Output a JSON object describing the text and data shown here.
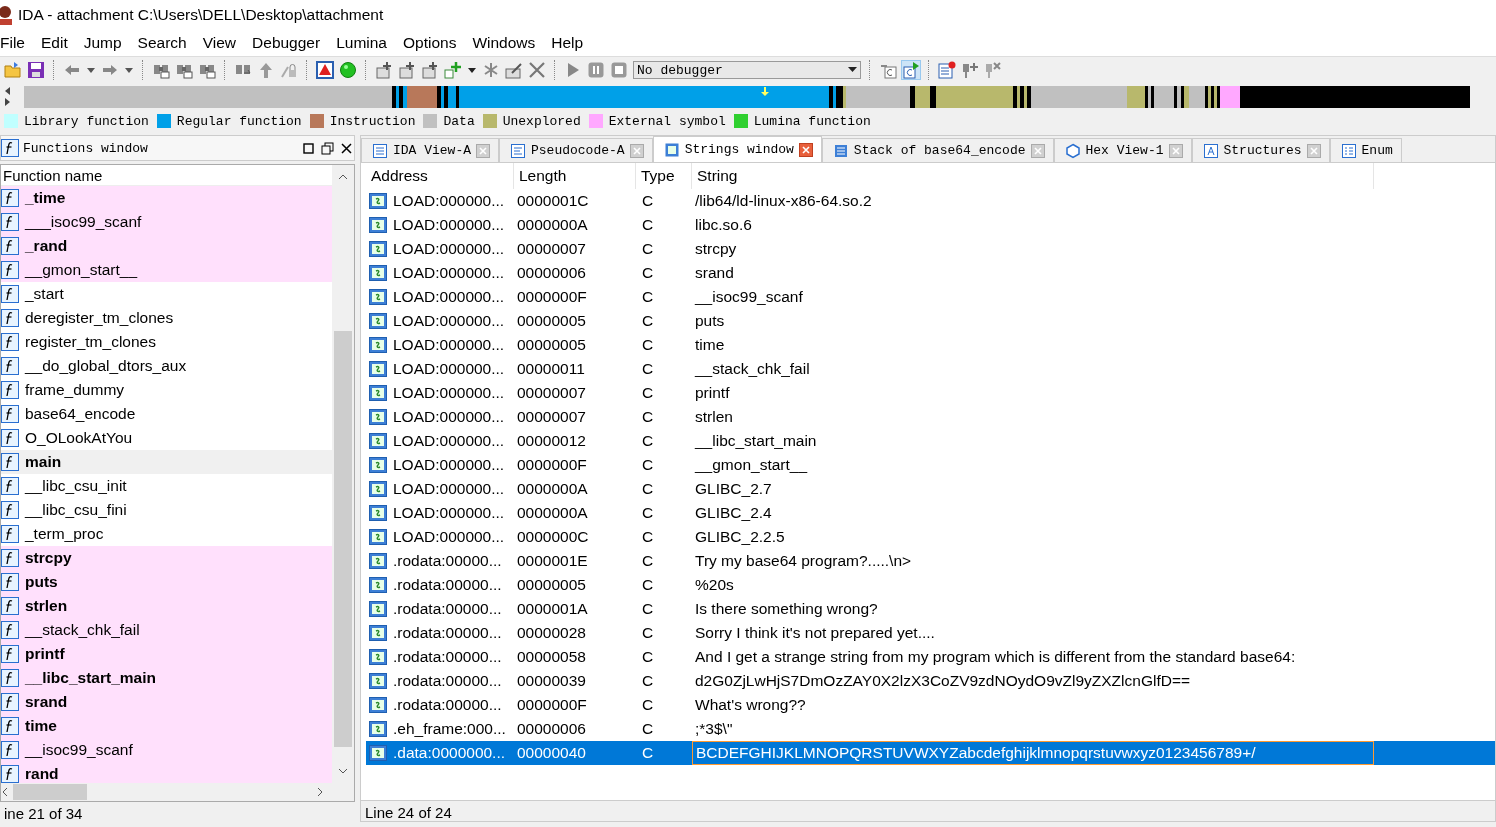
{
  "window": {
    "title": "IDA - attachment C:\\Users\\DELL\\Desktop\\attachment"
  },
  "menu": [
    "File",
    "Edit",
    "Jump",
    "Search",
    "View",
    "Debugger",
    "Lumina",
    "Options",
    "Windows",
    "Help"
  ],
  "toolbar": {
    "debugger_select": {
      "value": "No debugger"
    }
  },
  "legend": [
    {
      "label": "Library function",
      "color": "#c0ffff"
    },
    {
      "label": "Regular function",
      "color": "#00a0e8"
    },
    {
      "label": "Instruction",
      "color": "#b8785a"
    },
    {
      "label": "Data",
      "color": "#c0c0c0"
    },
    {
      "label": "Unexplored",
      "color": "#b8b86c"
    },
    {
      "label": "External symbol",
      "color": "#ffa8ff"
    },
    {
      "label": "Lumina function",
      "color": "#30d030"
    }
  ],
  "functions_window": {
    "title": "Functions window",
    "column": "Function name",
    "items": [
      {
        "name": "_time",
        "bold": true,
        "external": true,
        "selected": false
      },
      {
        "name": "___isoc99_scanf",
        "bold": false,
        "external": true,
        "selected": false
      },
      {
        "name": "_rand",
        "bold": true,
        "external": true,
        "selected": false
      },
      {
        "name": "__gmon_start__",
        "bold": false,
        "external": true,
        "selected": false
      },
      {
        "name": "_start",
        "bold": false,
        "external": false,
        "selected": false
      },
      {
        "name": "deregister_tm_clones",
        "bold": false,
        "external": false,
        "selected": false
      },
      {
        "name": "register_tm_clones",
        "bold": false,
        "external": false,
        "selected": false
      },
      {
        "name": "__do_global_dtors_aux",
        "bold": false,
        "external": false,
        "selected": false
      },
      {
        "name": "frame_dummy",
        "bold": false,
        "external": false,
        "selected": false
      },
      {
        "name": "base64_encode",
        "bold": false,
        "external": false,
        "selected": false
      },
      {
        "name": "O_OLookAtYou",
        "bold": false,
        "external": false,
        "selected": false
      },
      {
        "name": "main",
        "bold": true,
        "external": false,
        "selected": true
      },
      {
        "name": "__libc_csu_init",
        "bold": false,
        "external": false,
        "selected": false
      },
      {
        "name": "__libc_csu_fini",
        "bold": false,
        "external": false,
        "selected": false
      },
      {
        "name": "_term_proc",
        "bold": false,
        "external": false,
        "selected": false
      },
      {
        "name": "strcpy",
        "bold": true,
        "external": true,
        "selected": false
      },
      {
        "name": "puts",
        "bold": true,
        "external": true,
        "selected": false
      },
      {
        "name": "strlen",
        "bold": true,
        "external": true,
        "selected": false
      },
      {
        "name": "__stack_chk_fail",
        "bold": false,
        "external": true,
        "selected": false
      },
      {
        "name": "printf",
        "bold": true,
        "external": true,
        "selected": false
      },
      {
        "name": "__libc_start_main",
        "bold": true,
        "external": true,
        "selected": false
      },
      {
        "name": "srand",
        "bold": true,
        "external": true,
        "selected": false
      },
      {
        "name": "time",
        "bold": true,
        "external": true,
        "selected": false
      },
      {
        "name": "__isoc99_scanf",
        "bold": false,
        "external": true,
        "selected": false
      },
      {
        "name": "rand",
        "bold": true,
        "external": true,
        "selected": false
      }
    ],
    "status": "ine 21 of 34"
  },
  "tabs": [
    {
      "label": "IDA View-A",
      "kind": "disasm",
      "selected": false
    },
    {
      "label": "Pseudocode-A",
      "kind": "pseudocode",
      "selected": false
    },
    {
      "label": "Strings window",
      "kind": "strings",
      "selected": true
    },
    {
      "label": "Stack of base64_encode",
      "kind": "stack",
      "selected": false
    },
    {
      "label": "Hex View-1",
      "kind": "hex",
      "selected": false
    },
    {
      "label": "Structures",
      "kind": "structures",
      "selected": false
    },
    {
      "label": "Enum",
      "kind": "enums",
      "selected": false
    }
  ],
  "strings_table": {
    "columns": [
      "Address",
      "Length",
      "Type",
      "String"
    ],
    "rows": [
      {
        "address": "LOAD:000000...",
        "length": "0000001C",
        "type": "C",
        "string": "/lib64/ld-linux-x86-64.so.2",
        "selected": false
      },
      {
        "address": "LOAD:000000...",
        "length": "0000000A",
        "type": "C",
        "string": "libc.so.6",
        "selected": false
      },
      {
        "address": "LOAD:000000...",
        "length": "00000007",
        "type": "C",
        "string": "strcpy",
        "selected": false
      },
      {
        "address": "LOAD:000000...",
        "length": "00000006",
        "type": "C",
        "string": "srand",
        "selected": false
      },
      {
        "address": "LOAD:000000...",
        "length": "0000000F",
        "type": "C",
        "string": "__isoc99_scanf",
        "selected": false
      },
      {
        "address": "LOAD:000000...",
        "length": "00000005",
        "type": "C",
        "string": "puts",
        "selected": false
      },
      {
        "address": "LOAD:000000...",
        "length": "00000005",
        "type": "C",
        "string": "time",
        "selected": false
      },
      {
        "address": "LOAD:000000...",
        "length": "00000011",
        "type": "C",
        "string": "__stack_chk_fail",
        "selected": false
      },
      {
        "address": "LOAD:000000...",
        "length": "00000007",
        "type": "C",
        "string": "printf",
        "selected": false
      },
      {
        "address": "LOAD:000000...",
        "length": "00000007",
        "type": "C",
        "string": "strlen",
        "selected": false
      },
      {
        "address": "LOAD:000000...",
        "length": "00000012",
        "type": "C",
        "string": "__libc_start_main",
        "selected": false
      },
      {
        "address": "LOAD:000000...",
        "length": "0000000F",
        "type": "C",
        "string": "__gmon_start__",
        "selected": false
      },
      {
        "address": "LOAD:000000...",
        "length": "0000000A",
        "type": "C",
        "string": "GLIBC_2.7",
        "selected": false
      },
      {
        "address": "LOAD:000000...",
        "length": "0000000A",
        "type": "C",
        "string": "GLIBC_2.4",
        "selected": false
      },
      {
        "address": "LOAD:000000...",
        "length": "0000000C",
        "type": "C",
        "string": "GLIBC_2.2.5",
        "selected": false
      },
      {
        "address": ".rodata:00000...",
        "length": "0000001E",
        "type": "C",
        "string": "Try my base64 program?.....\\n>",
        "selected": false
      },
      {
        "address": ".rodata:00000...",
        "length": "00000005",
        "type": "C",
        "string": "%20s",
        "selected": false
      },
      {
        "address": ".rodata:00000...",
        "length": "0000001A",
        "type": "C",
        "string": "Is there something wrong?",
        "selected": false
      },
      {
        "address": ".rodata:00000...",
        "length": "00000028",
        "type": "C",
        "string": "Sorry I think it's not prepared yet....",
        "selected": false
      },
      {
        "address": ".rodata:00000...",
        "length": "00000058",
        "type": "C",
        "string": "And I get a strange string from my program which is different from the standard base64:",
        "selected": false
      },
      {
        "address": ".rodata:00000...",
        "length": "00000039",
        "type": "C",
        "string": "d2G0ZjLwHjS7DmOzZAY0X2lzX3CoZV9zdNOydO9vZl9yZXZlcnGlfD==",
        "selected": false
      },
      {
        "address": ".rodata:00000...",
        "length": "0000000F",
        "type": "C",
        "string": "What's wrong??",
        "selected": false
      },
      {
        "address": ".eh_frame:000...",
        "length": "00000006",
        "type": "C",
        "string": ";*3$\\\"",
        "selected": false
      },
      {
        "address": ".data:0000000...",
        "length": "00000040",
        "type": "C",
        "string": "BCDEFGHIJKLMNOPQRSTUVWXYZabcdefghijklmnopqrstuvwxyz0123456789+/",
        "selected": true
      }
    ],
    "status": "Line 24 of 24"
  }
}
